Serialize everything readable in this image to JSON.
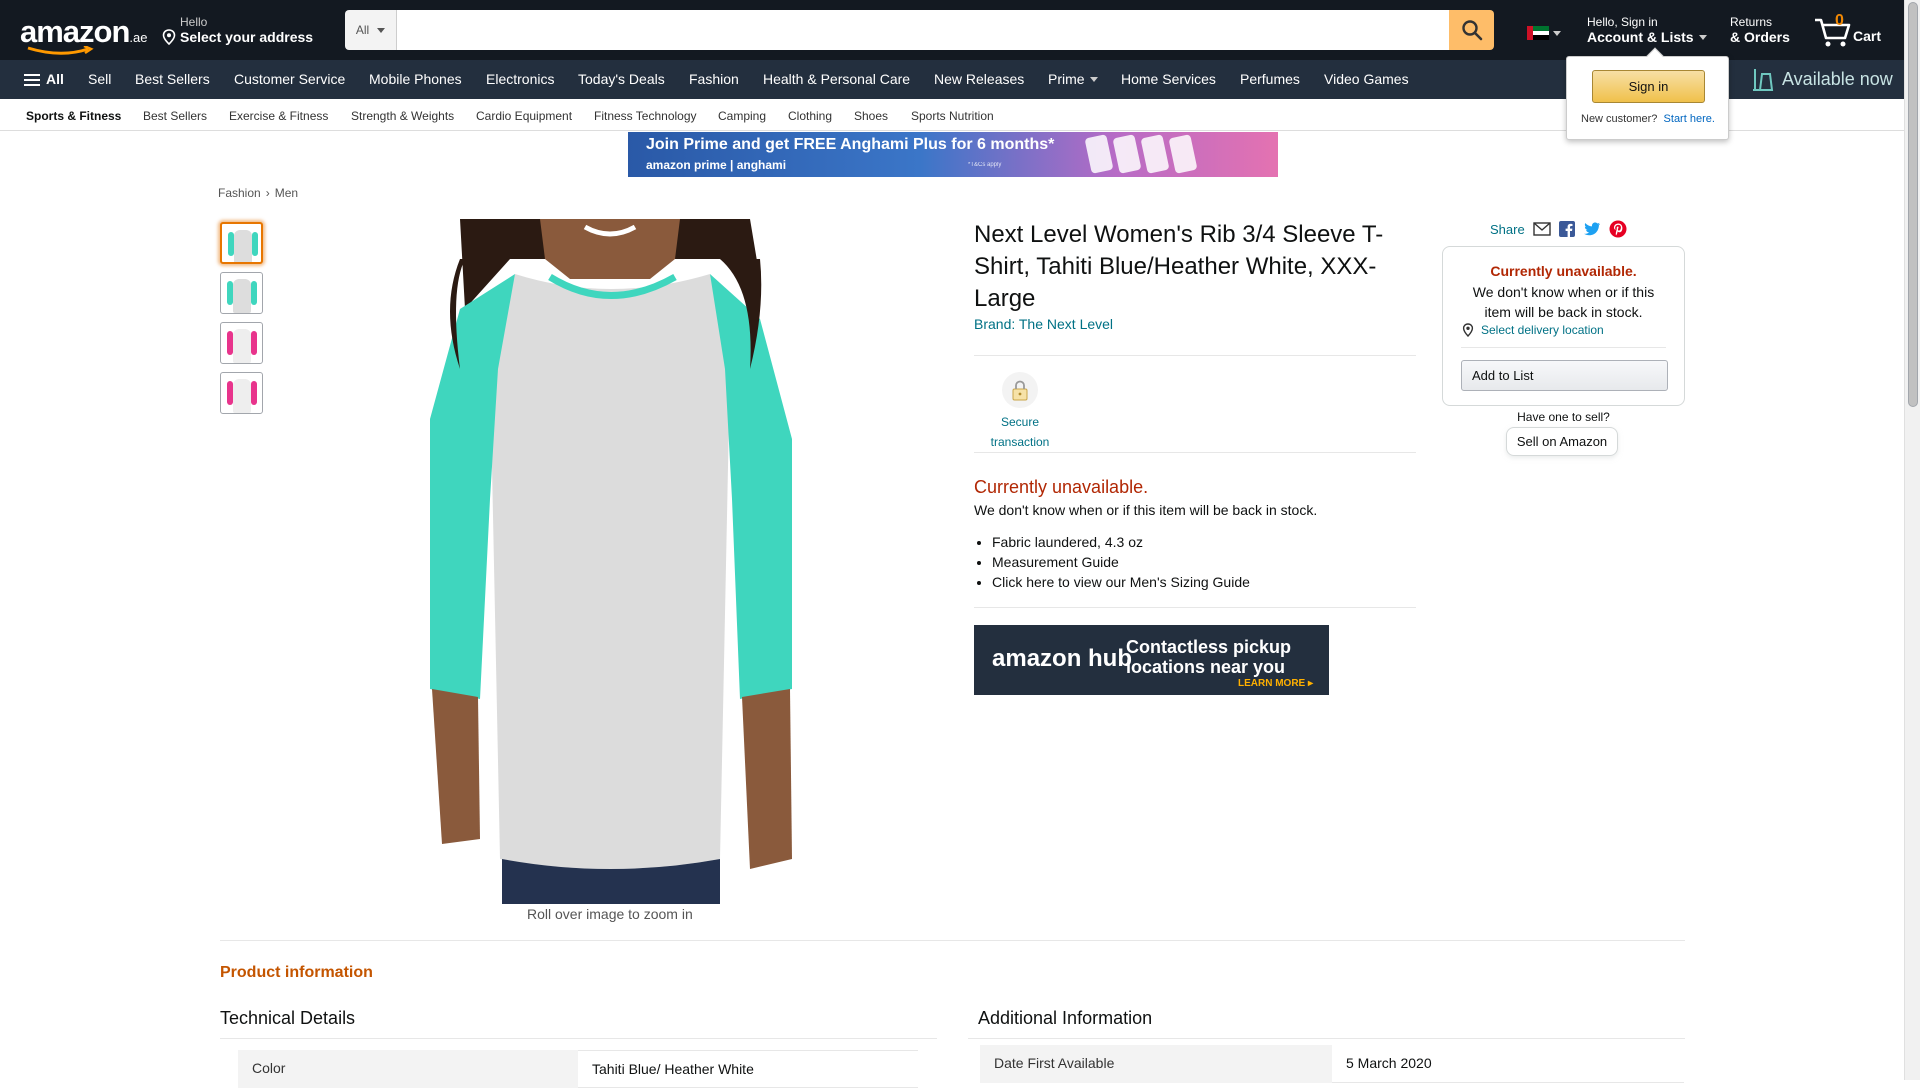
{
  "topnav": {
    "logo": "amazon",
    "logo_tld": ".ae",
    "deliver_line1": "Hello",
    "deliver_line2": "Select your address",
    "search_category": "All",
    "search_placeholder": "",
    "account_line1": "Hello, Sign in",
    "account_line2": "Account & Lists",
    "returns_line1": "Returns",
    "returns_line2": "& Orders",
    "cart_count": "0",
    "cart_label": "Cart"
  },
  "mainnav": {
    "all_label": "All",
    "items": [
      "Sell",
      "Best Sellers",
      "Customer Service",
      "Mobile Phones",
      "Electronics",
      "Today's Deals",
      "Fashion",
      "Health & Personal Care",
      "New Releases",
      "Prime",
      "Home Services",
      "Perfumes",
      "Video Games"
    ],
    "promo_text": "Available now"
  },
  "subnav": {
    "items": [
      "Sports & Fitness",
      "Best Sellers",
      "Exercise & Fitness",
      "Strength & Weights",
      "Cardio Equipment",
      "Fitness Technology",
      "Camping",
      "Clothing",
      "Shoes",
      "Sports Nutrition"
    ]
  },
  "banner": {
    "line1": "Join Prime and get FREE Anghami Plus for 6 months*",
    "line2": "amazon prime  |  anghami",
    "terms": "*T&Cs apply"
  },
  "signin_popover": {
    "button": "Sign in",
    "new_customer": "New customer?",
    "start_here": "Start here."
  },
  "breadcrumb": [
    "Fashion",
    "Men"
  ],
  "product": {
    "title": "Next Level Women's Rib 3/4 Sleeve T-Shirt, Tahiti Blue/Heather White, XXX-Large",
    "brand": "Brand: The Next Level",
    "secure_label": "Secure transaction",
    "unavailable_heading": "Currently unavailable.",
    "unavailable_text": "We don't know when or if this item will be back in stock.",
    "bullets": [
      "Fabric laundered, 4.3 oz",
      "Measurement Guide",
      "Click here to view our Men's Sizing Guide"
    ],
    "zoom_hint": "Roll over image to zoom in"
  },
  "hub_ad": {
    "brand": "amazon hub",
    "headline": "Contactless pickup locations near you",
    "cta": "LEARN MORE ▸"
  },
  "buybox": {
    "share": "Share",
    "heading": "Currently unavailable.",
    "text": "We don't know when or if this item will be back in stock.",
    "location": "Select delivery location",
    "add_to_list": "Add to List",
    "have_one": "Have one to sell?",
    "sell_button": "Sell on Amazon"
  },
  "product_info": {
    "heading": "Product information",
    "technical_heading": "Technical Details",
    "additional_heading": "Additional Information",
    "technical_rows": [
      {
        "key": "Color",
        "value": "Tahiti Blue/ Heather White"
      }
    ],
    "additional_rows": [
      {
        "key": "Date First Available",
        "value": "5 March 2020"
      }
    ]
  },
  "colors": {
    "nav_dark": "#131921",
    "nav_secondary": "#232f3e",
    "accent_orange": "#febd69",
    "link_teal": "#007185",
    "unavailable_red": "#b12704",
    "shirt_teal": "#3fd6be",
    "shirt_grey": "#d9d9d9"
  }
}
